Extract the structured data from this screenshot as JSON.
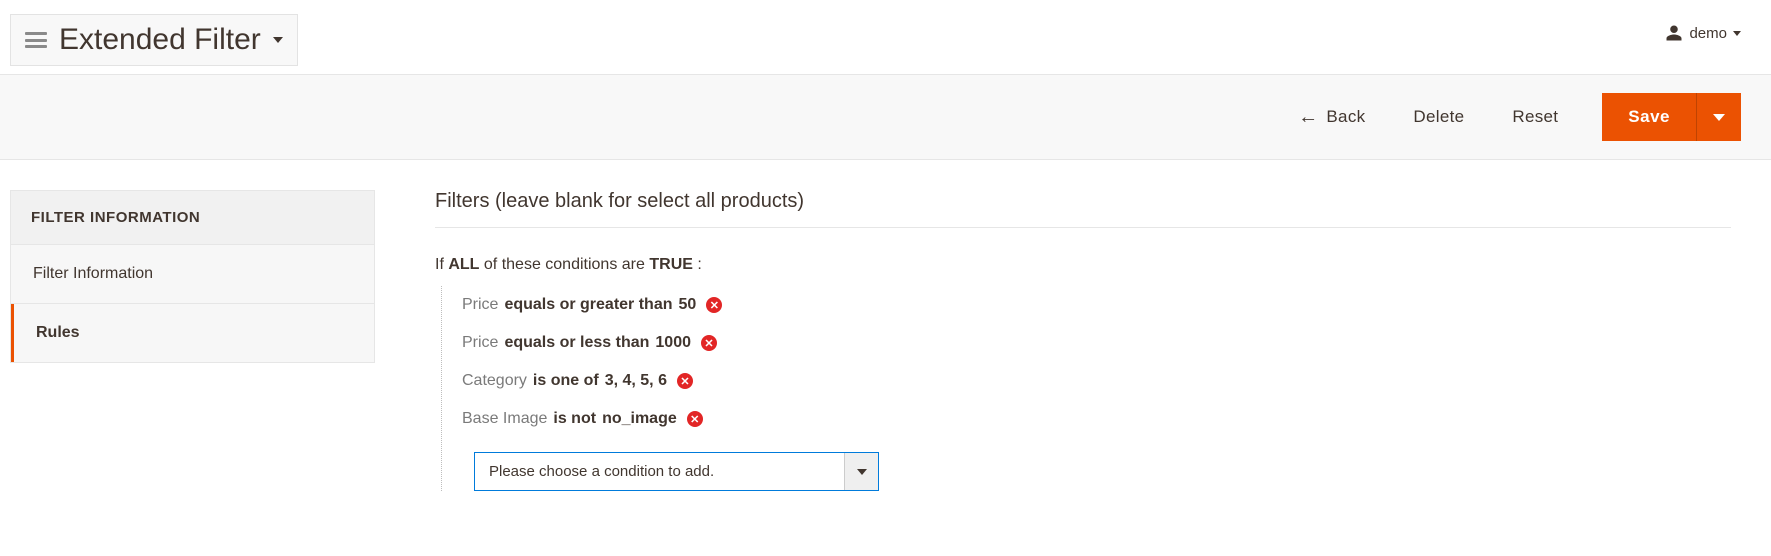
{
  "header": {
    "title": "Extended Filter"
  },
  "user": {
    "name": "demo"
  },
  "actions": {
    "back": "Back",
    "delete": "Delete",
    "reset": "Reset",
    "save": "Save"
  },
  "sidebar": {
    "heading": "FILTER INFORMATION",
    "items": [
      {
        "label": "Filter Information"
      },
      {
        "label": "Rules"
      }
    ]
  },
  "main": {
    "section_title": "Filters (leave blank for select all products)",
    "intro": {
      "prefix": "If",
      "aggregator": "ALL",
      "mid": "of these conditions are",
      "value_bool": "TRUE",
      "suffix": ":"
    },
    "conditions": [
      {
        "attribute": "Price",
        "operator": "equals or greater than",
        "value": "50"
      },
      {
        "attribute": "Price",
        "operator": "equals or less than",
        "value": "1000"
      },
      {
        "attribute": "Category",
        "operator": "is one of",
        "value": "3, 4, 5, 6"
      },
      {
        "attribute": "Base Image",
        "operator": "is not",
        "value": "no_image"
      }
    ],
    "add_placeholder": "Please choose a condition to add."
  }
}
